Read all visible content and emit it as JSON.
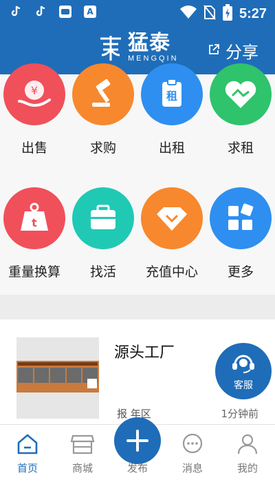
{
  "status_bar": {
    "time": "5:27",
    "icons": [
      "tiktok-icon",
      "tiktok-icon",
      "app-icon",
      "a-icon",
      "wifi-icon",
      "no-sim-icon",
      "battery-icon"
    ],
    "a_label": "A"
  },
  "header": {
    "logo_text": "猛泰",
    "logo_subtext": "MENGQIN",
    "share_label": "分享",
    "color": "#1f6db8"
  },
  "categories": [
    {
      "label": "出售",
      "icon": "yuan-hand-icon",
      "color": "#f0505a"
    },
    {
      "label": "求购",
      "icon": "gavel-icon",
      "color": "#f7882d"
    },
    {
      "label": "出租",
      "icon": "rent-icon",
      "color": "#2e8ff0",
      "glyph": "租"
    },
    {
      "label": "求租",
      "icon": "handshake-heart-icon",
      "color": "#2fc36b"
    },
    {
      "label": "重量换算",
      "icon": "weight-icon",
      "color": "#f0505a",
      "glyph": "t"
    },
    {
      "label": "找活",
      "icon": "briefcase-icon",
      "color": "#20c9b4"
    },
    {
      "label": "充值中心",
      "icon": "diamond-icon",
      "color": "#f7882d"
    },
    {
      "label": "更多",
      "icon": "grid-icon",
      "color": "#2e8ff0"
    }
  ],
  "listing": {
    "title": "源头工厂",
    "region_visible": "报   年区",
    "time": "1分钟前"
  },
  "service": {
    "label": "客服"
  },
  "tabs": [
    {
      "label": "首页",
      "icon": "home-icon",
      "active": true
    },
    {
      "label": "商城",
      "icon": "store-icon",
      "active": false
    },
    {
      "label": "发布",
      "icon": "plus-icon",
      "active": false
    },
    {
      "label": "消息",
      "icon": "chat-icon",
      "active": false
    },
    {
      "label": "我的",
      "icon": "user-icon",
      "active": false
    }
  ]
}
